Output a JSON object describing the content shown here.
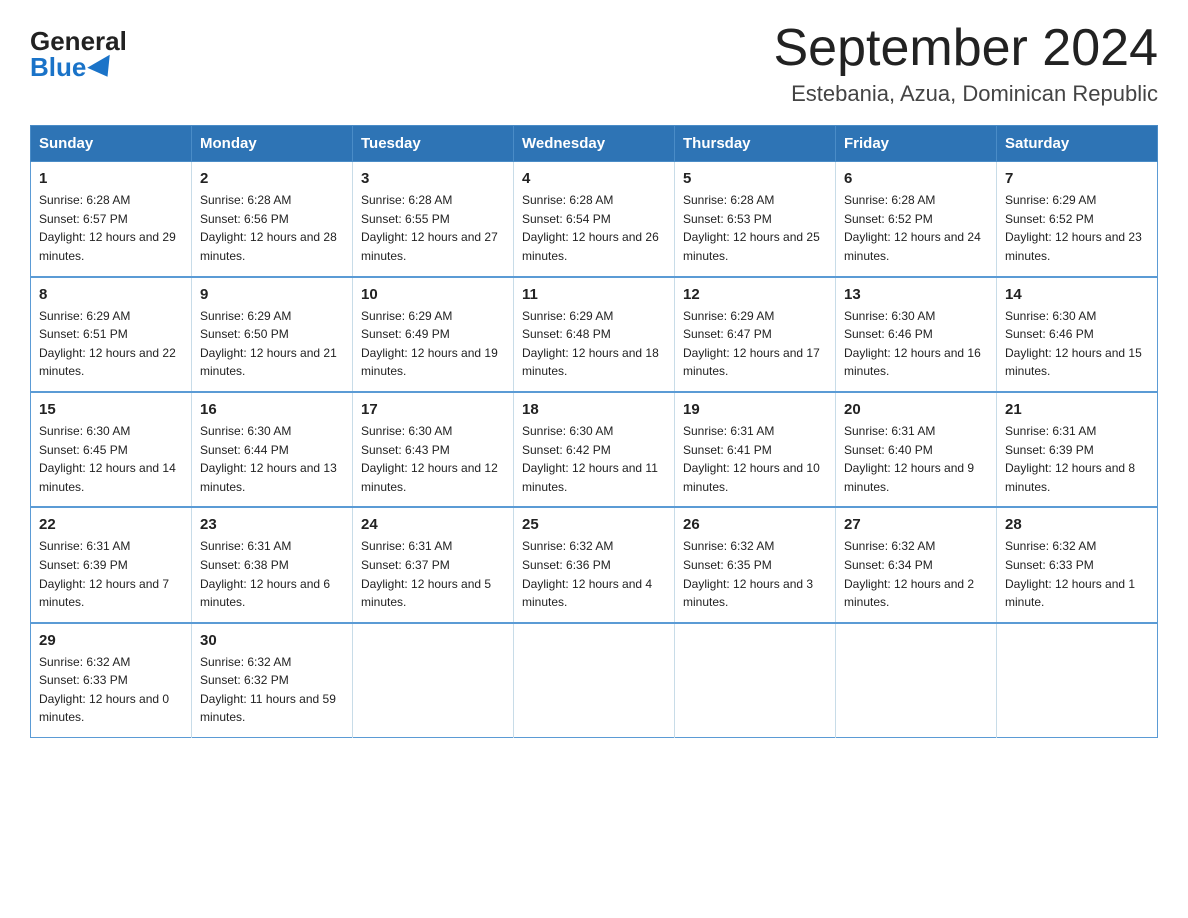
{
  "header": {
    "logo_general": "General",
    "logo_blue": "Blue",
    "month_title": "September 2024",
    "location": "Estebania, Azua, Dominican Republic"
  },
  "days_of_week": [
    "Sunday",
    "Monday",
    "Tuesday",
    "Wednesday",
    "Thursday",
    "Friday",
    "Saturday"
  ],
  "weeks": [
    [
      {
        "day": "1",
        "sunrise": "Sunrise: 6:28 AM",
        "sunset": "Sunset: 6:57 PM",
        "daylight": "Daylight: 12 hours and 29 minutes."
      },
      {
        "day": "2",
        "sunrise": "Sunrise: 6:28 AM",
        "sunset": "Sunset: 6:56 PM",
        "daylight": "Daylight: 12 hours and 28 minutes."
      },
      {
        "day": "3",
        "sunrise": "Sunrise: 6:28 AM",
        "sunset": "Sunset: 6:55 PM",
        "daylight": "Daylight: 12 hours and 27 minutes."
      },
      {
        "day": "4",
        "sunrise": "Sunrise: 6:28 AM",
        "sunset": "Sunset: 6:54 PM",
        "daylight": "Daylight: 12 hours and 26 minutes."
      },
      {
        "day": "5",
        "sunrise": "Sunrise: 6:28 AM",
        "sunset": "Sunset: 6:53 PM",
        "daylight": "Daylight: 12 hours and 25 minutes."
      },
      {
        "day": "6",
        "sunrise": "Sunrise: 6:28 AM",
        "sunset": "Sunset: 6:52 PM",
        "daylight": "Daylight: 12 hours and 24 minutes."
      },
      {
        "day": "7",
        "sunrise": "Sunrise: 6:29 AM",
        "sunset": "Sunset: 6:52 PM",
        "daylight": "Daylight: 12 hours and 23 minutes."
      }
    ],
    [
      {
        "day": "8",
        "sunrise": "Sunrise: 6:29 AM",
        "sunset": "Sunset: 6:51 PM",
        "daylight": "Daylight: 12 hours and 22 minutes."
      },
      {
        "day": "9",
        "sunrise": "Sunrise: 6:29 AM",
        "sunset": "Sunset: 6:50 PM",
        "daylight": "Daylight: 12 hours and 21 minutes."
      },
      {
        "day": "10",
        "sunrise": "Sunrise: 6:29 AM",
        "sunset": "Sunset: 6:49 PM",
        "daylight": "Daylight: 12 hours and 19 minutes."
      },
      {
        "day": "11",
        "sunrise": "Sunrise: 6:29 AM",
        "sunset": "Sunset: 6:48 PM",
        "daylight": "Daylight: 12 hours and 18 minutes."
      },
      {
        "day": "12",
        "sunrise": "Sunrise: 6:29 AM",
        "sunset": "Sunset: 6:47 PM",
        "daylight": "Daylight: 12 hours and 17 minutes."
      },
      {
        "day": "13",
        "sunrise": "Sunrise: 6:30 AM",
        "sunset": "Sunset: 6:46 PM",
        "daylight": "Daylight: 12 hours and 16 minutes."
      },
      {
        "day": "14",
        "sunrise": "Sunrise: 6:30 AM",
        "sunset": "Sunset: 6:46 PM",
        "daylight": "Daylight: 12 hours and 15 minutes."
      }
    ],
    [
      {
        "day": "15",
        "sunrise": "Sunrise: 6:30 AM",
        "sunset": "Sunset: 6:45 PM",
        "daylight": "Daylight: 12 hours and 14 minutes."
      },
      {
        "day": "16",
        "sunrise": "Sunrise: 6:30 AM",
        "sunset": "Sunset: 6:44 PM",
        "daylight": "Daylight: 12 hours and 13 minutes."
      },
      {
        "day": "17",
        "sunrise": "Sunrise: 6:30 AM",
        "sunset": "Sunset: 6:43 PM",
        "daylight": "Daylight: 12 hours and 12 minutes."
      },
      {
        "day": "18",
        "sunrise": "Sunrise: 6:30 AM",
        "sunset": "Sunset: 6:42 PM",
        "daylight": "Daylight: 12 hours and 11 minutes."
      },
      {
        "day": "19",
        "sunrise": "Sunrise: 6:31 AM",
        "sunset": "Sunset: 6:41 PM",
        "daylight": "Daylight: 12 hours and 10 minutes."
      },
      {
        "day": "20",
        "sunrise": "Sunrise: 6:31 AM",
        "sunset": "Sunset: 6:40 PM",
        "daylight": "Daylight: 12 hours and 9 minutes."
      },
      {
        "day": "21",
        "sunrise": "Sunrise: 6:31 AM",
        "sunset": "Sunset: 6:39 PM",
        "daylight": "Daylight: 12 hours and 8 minutes."
      }
    ],
    [
      {
        "day": "22",
        "sunrise": "Sunrise: 6:31 AM",
        "sunset": "Sunset: 6:39 PM",
        "daylight": "Daylight: 12 hours and 7 minutes."
      },
      {
        "day": "23",
        "sunrise": "Sunrise: 6:31 AM",
        "sunset": "Sunset: 6:38 PM",
        "daylight": "Daylight: 12 hours and 6 minutes."
      },
      {
        "day": "24",
        "sunrise": "Sunrise: 6:31 AM",
        "sunset": "Sunset: 6:37 PM",
        "daylight": "Daylight: 12 hours and 5 minutes."
      },
      {
        "day": "25",
        "sunrise": "Sunrise: 6:32 AM",
        "sunset": "Sunset: 6:36 PM",
        "daylight": "Daylight: 12 hours and 4 minutes."
      },
      {
        "day": "26",
        "sunrise": "Sunrise: 6:32 AM",
        "sunset": "Sunset: 6:35 PM",
        "daylight": "Daylight: 12 hours and 3 minutes."
      },
      {
        "day": "27",
        "sunrise": "Sunrise: 6:32 AM",
        "sunset": "Sunset: 6:34 PM",
        "daylight": "Daylight: 12 hours and 2 minutes."
      },
      {
        "day": "28",
        "sunrise": "Sunrise: 6:32 AM",
        "sunset": "Sunset: 6:33 PM",
        "daylight": "Daylight: 12 hours and 1 minute."
      }
    ],
    [
      {
        "day": "29",
        "sunrise": "Sunrise: 6:32 AM",
        "sunset": "Sunset: 6:33 PM",
        "daylight": "Daylight: 12 hours and 0 minutes."
      },
      {
        "day": "30",
        "sunrise": "Sunrise: 6:32 AM",
        "sunset": "Sunset: 6:32 PM",
        "daylight": "Daylight: 11 hours and 59 minutes."
      },
      null,
      null,
      null,
      null,
      null
    ]
  ]
}
